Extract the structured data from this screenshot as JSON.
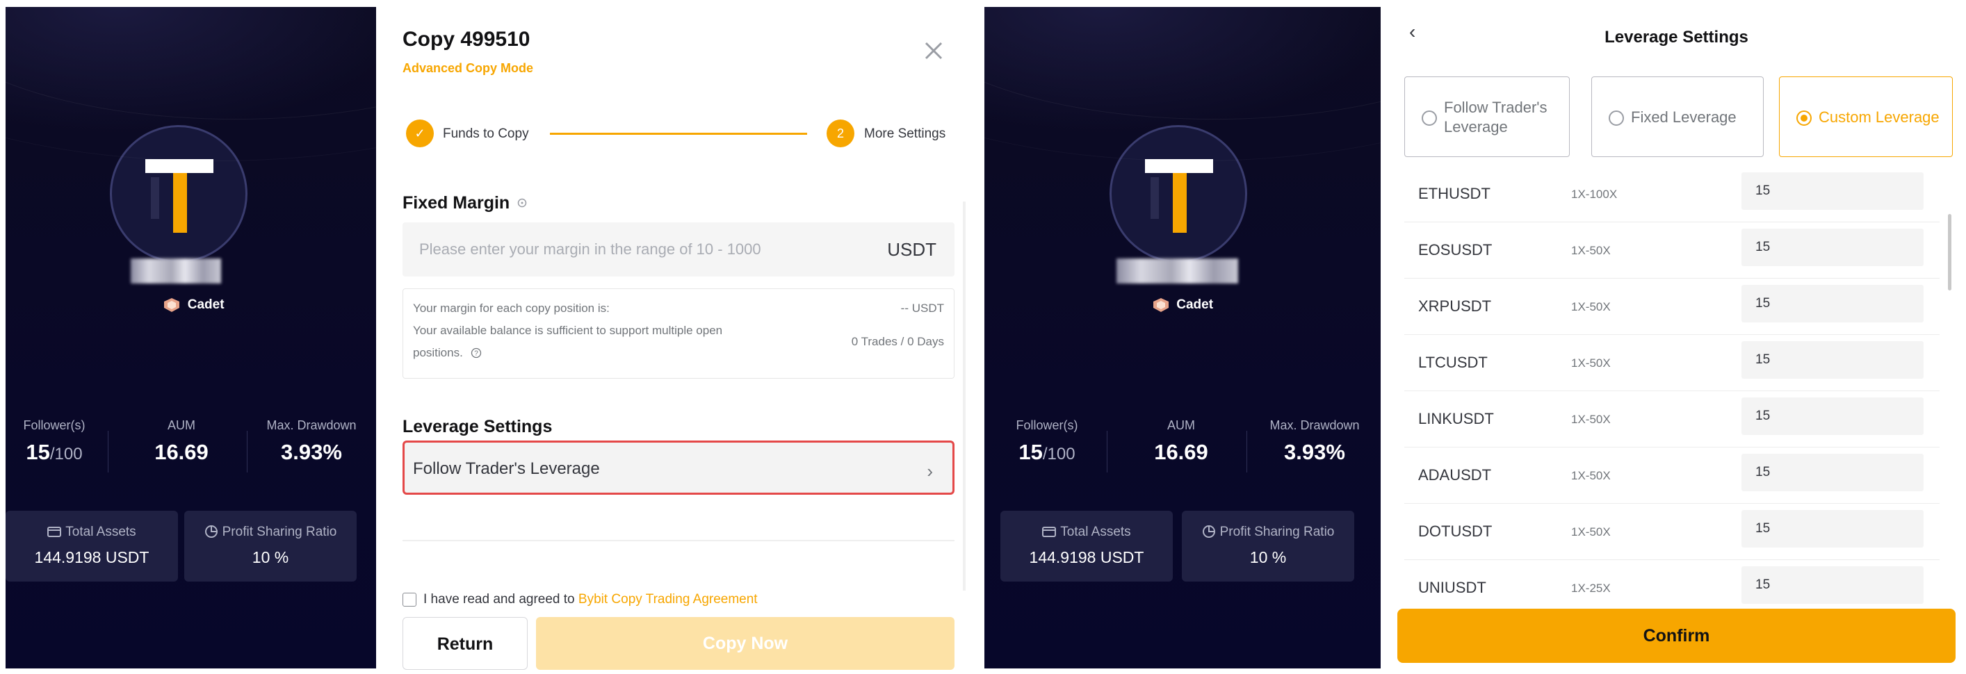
{
  "trader": {
    "badge": "Cadet",
    "stats": [
      {
        "label": "Follower(s)",
        "value": "15",
        "value_suffix": "/100"
      },
      {
        "label": "AUM",
        "value": "16.69",
        "value_suffix": ""
      },
      {
        "label": "Max. Drawdown",
        "value": "3.93%",
        "value_suffix": ""
      }
    ],
    "total_assets": {
      "label": "Total Assets",
      "value": "144.9198 USDT",
      "icon": "wallet-icon"
    },
    "profit_sharing": {
      "label": "Profit Sharing Ratio",
      "value": "10 %",
      "icon": "pie-chart-icon"
    }
  },
  "copy_modal": {
    "title": "Copy 499510",
    "subtitle": "Advanced Copy Mode",
    "steps": [
      {
        "marker": "✓",
        "label": "Funds to Copy"
      },
      {
        "marker": "2",
        "label": "More Settings"
      }
    ],
    "fixed_margin": {
      "title": "Fixed Margin",
      "placeholder": "Please enter your margin in the range of 10 - 1000",
      "unit": "USDT",
      "info_line1": "Your margin for each copy position is:",
      "info_line1_value": "-- USDT",
      "info_line2": "Your available balance is sufficient to support multiple open",
      "info_line3": "positions.",
      "info_line2_value": "0 Trades / 0 Days"
    },
    "leverage": {
      "title": "Leverage Settings",
      "selected": "Follow Trader's Leverage"
    },
    "agreement": {
      "prefix": "I have read and agreed to",
      "link": "Bybit Copy Trading Agreement"
    },
    "return_label": "Return",
    "copy_label": "Copy Now"
  },
  "leverage_panel": {
    "title": "Leverage Settings",
    "options": [
      "Follow Trader's Leverage",
      "Fixed Leverage",
      "Custom Leverage"
    ],
    "selected_option": "Custom Leverage",
    "pairs": [
      {
        "symbol": "ETHUSDT",
        "range": "1X-100X",
        "value": "15"
      },
      {
        "symbol": "EOSUSDT",
        "range": "1X-50X",
        "value": "15"
      },
      {
        "symbol": "XRPUSDT",
        "range": "1X-50X",
        "value": "15"
      },
      {
        "symbol": "LTCUSDT",
        "range": "1X-50X",
        "value": "15"
      },
      {
        "symbol": "LINKUSDT",
        "range": "1X-50X",
        "value": "15"
      },
      {
        "symbol": "ADAUSDT",
        "range": "1X-50X",
        "value": "15"
      },
      {
        "symbol": "DOTUSDT",
        "range": "1X-50X",
        "value": "15"
      },
      {
        "symbol": "UNIUSDT",
        "range": "1X-25X",
        "value": "15"
      }
    ],
    "confirm_label": "Confirm"
  },
  "colors": {
    "accent": "#f7a600",
    "dark_bg": "#0a0a28",
    "highlight_border": "#e44848"
  }
}
